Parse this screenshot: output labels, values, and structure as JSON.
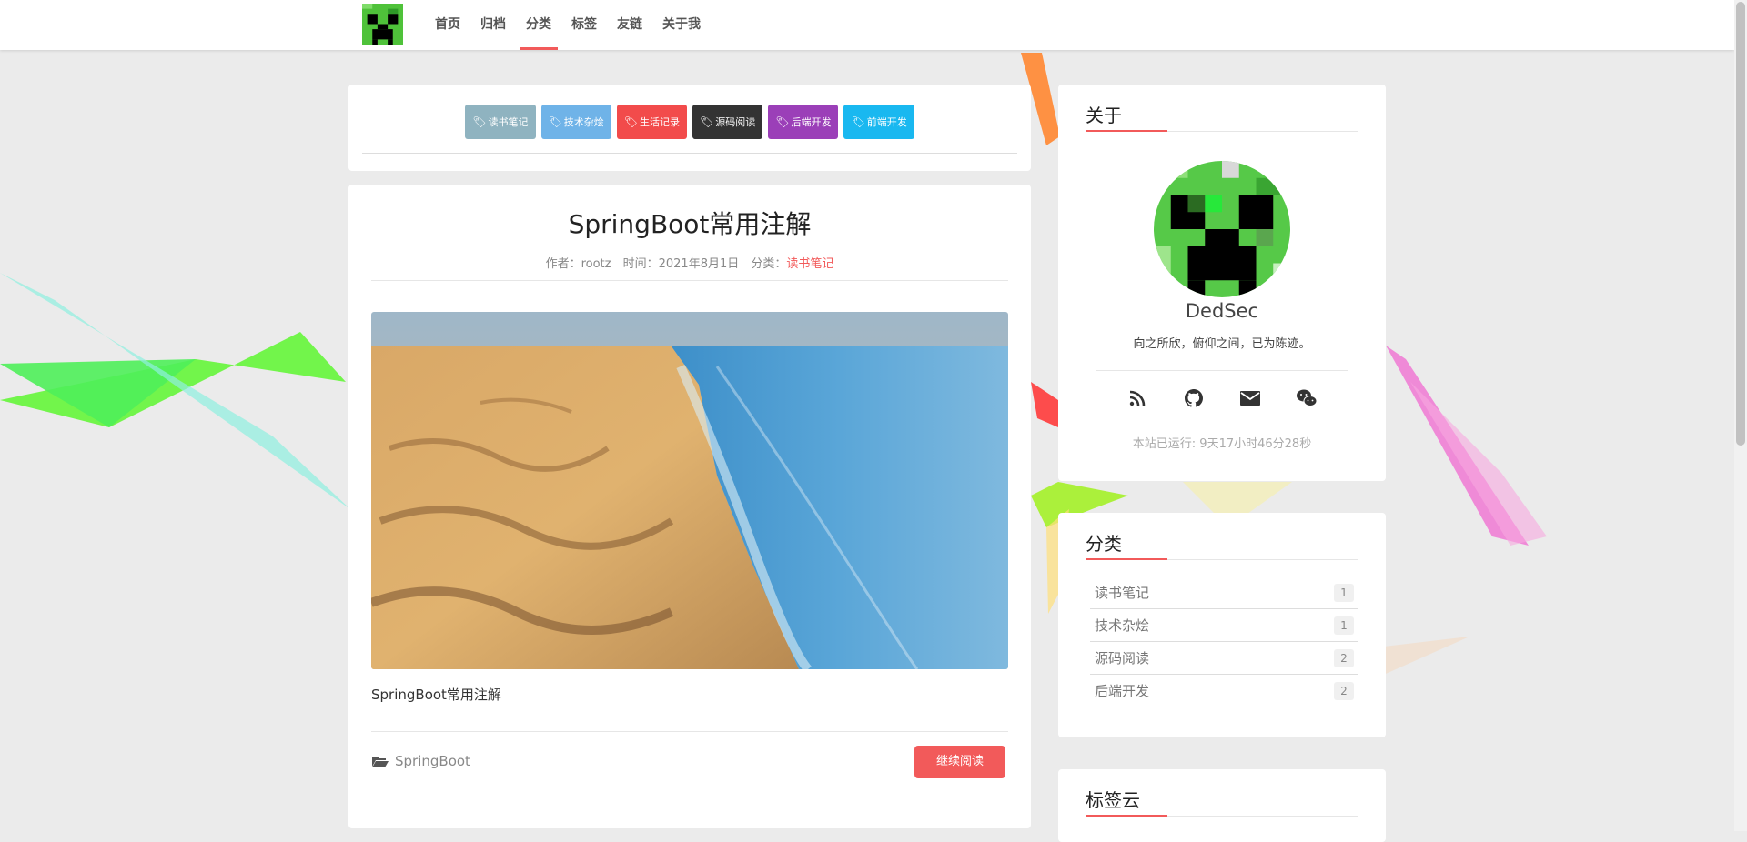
{
  "colors": {
    "accent": "#f25a5a",
    "page_bg": "#ebebeb"
  },
  "nav": {
    "logo_icon": "creeper-logo-icon",
    "items": [
      {
        "label": "首页"
      },
      {
        "label": "归档"
      },
      {
        "label": "分类",
        "active": true
      },
      {
        "label": "标签"
      },
      {
        "label": "友链"
      },
      {
        "label": "关于我"
      }
    ]
  },
  "tagbar": {
    "tags": [
      {
        "label": "读书笔记",
        "color": "#8fb3c0"
      },
      {
        "label": "技术杂烩",
        "color": "#6fb3e8"
      },
      {
        "label": "生活记录",
        "color": "#f24b4b"
      },
      {
        "label": "源码阅读",
        "color": "#333333"
      },
      {
        "label": "后端开发",
        "color": "#9b3fb8"
      },
      {
        "label": "前端开发",
        "color": "#19b8f0"
      }
    ],
    "tag_icon": "tag-icon"
  },
  "post": {
    "title": "SpringBoot常用注解",
    "meta": {
      "author_label": "作者：rootz",
      "time_label": "时间：2021年8月1日",
      "category_prefix": "分类：",
      "category": "读书笔记"
    },
    "image": "desert-meets-ocean-photo",
    "excerpt": "SpringBoot常用注解",
    "tag": "SpringBoot",
    "tag_icon": "folder-open-icon",
    "read_more": "继续阅读"
  },
  "sidebar": {
    "about": {
      "title": "关于",
      "name": "DedSec",
      "motto": "向之所欣，俯仰之间，已为陈迹。",
      "social_icons": [
        "rss-icon",
        "github-icon",
        "mail-icon",
        "wechat-icon"
      ],
      "uptime": "本站已运行: 9天17小时46分28秒"
    },
    "categories": {
      "title": "分类",
      "items": [
        {
          "name": "读书笔记",
          "count": "1"
        },
        {
          "name": "技术杂烩",
          "count": "1"
        },
        {
          "name": "源码阅读",
          "count": "2"
        },
        {
          "name": "后端开发",
          "count": "2"
        }
      ]
    },
    "tagcloud": {
      "title": "标签云"
    }
  }
}
